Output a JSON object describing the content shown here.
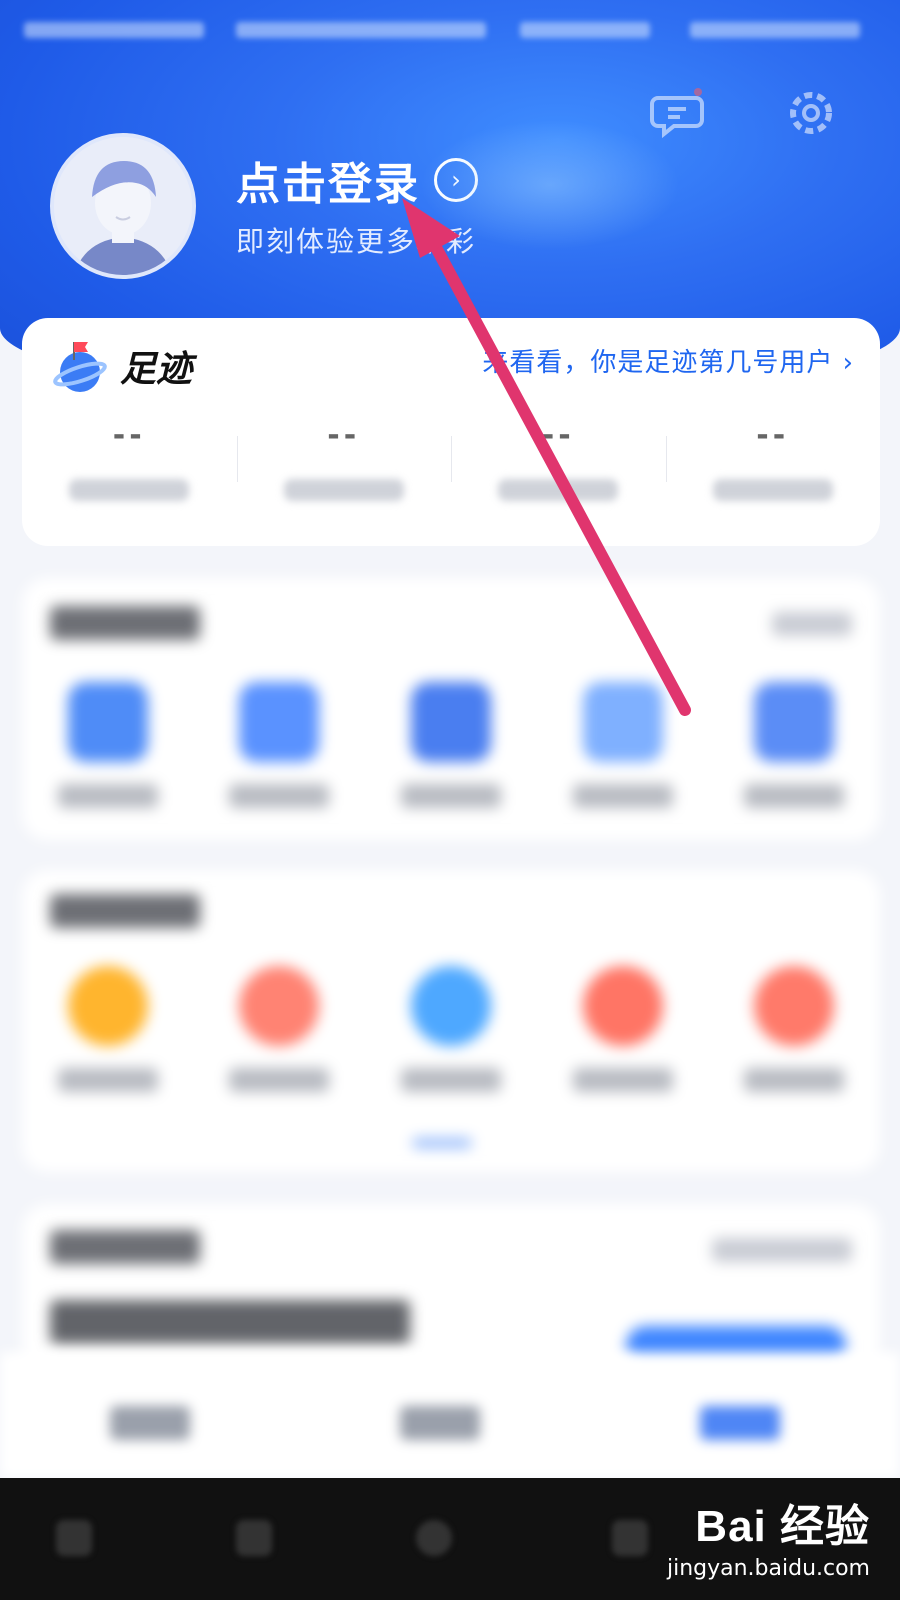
{
  "profile": {
    "login_label": "点击登录",
    "login_chevron": "›",
    "subtitle": "即刻体验更多精彩"
  },
  "footprint": {
    "title": "足迹",
    "link": "来看看，你是足迹第几号用户 ›",
    "stats": [
      {
        "value": "--"
      },
      {
        "value": "--"
      },
      {
        "value": "--"
      },
      {
        "value": "--"
      }
    ]
  },
  "colors": {
    "brand_blue": "#1f5be8",
    "link_blue": "#1f66f0",
    "annotation_arrow": "#e0356e"
  },
  "icons": {
    "message": "message-icon",
    "settings": "gear-icon",
    "avatar": "default-avatar"
  },
  "watermark": {
    "logo": "Bai  经验",
    "url": "jingyan.baidu.com"
  }
}
